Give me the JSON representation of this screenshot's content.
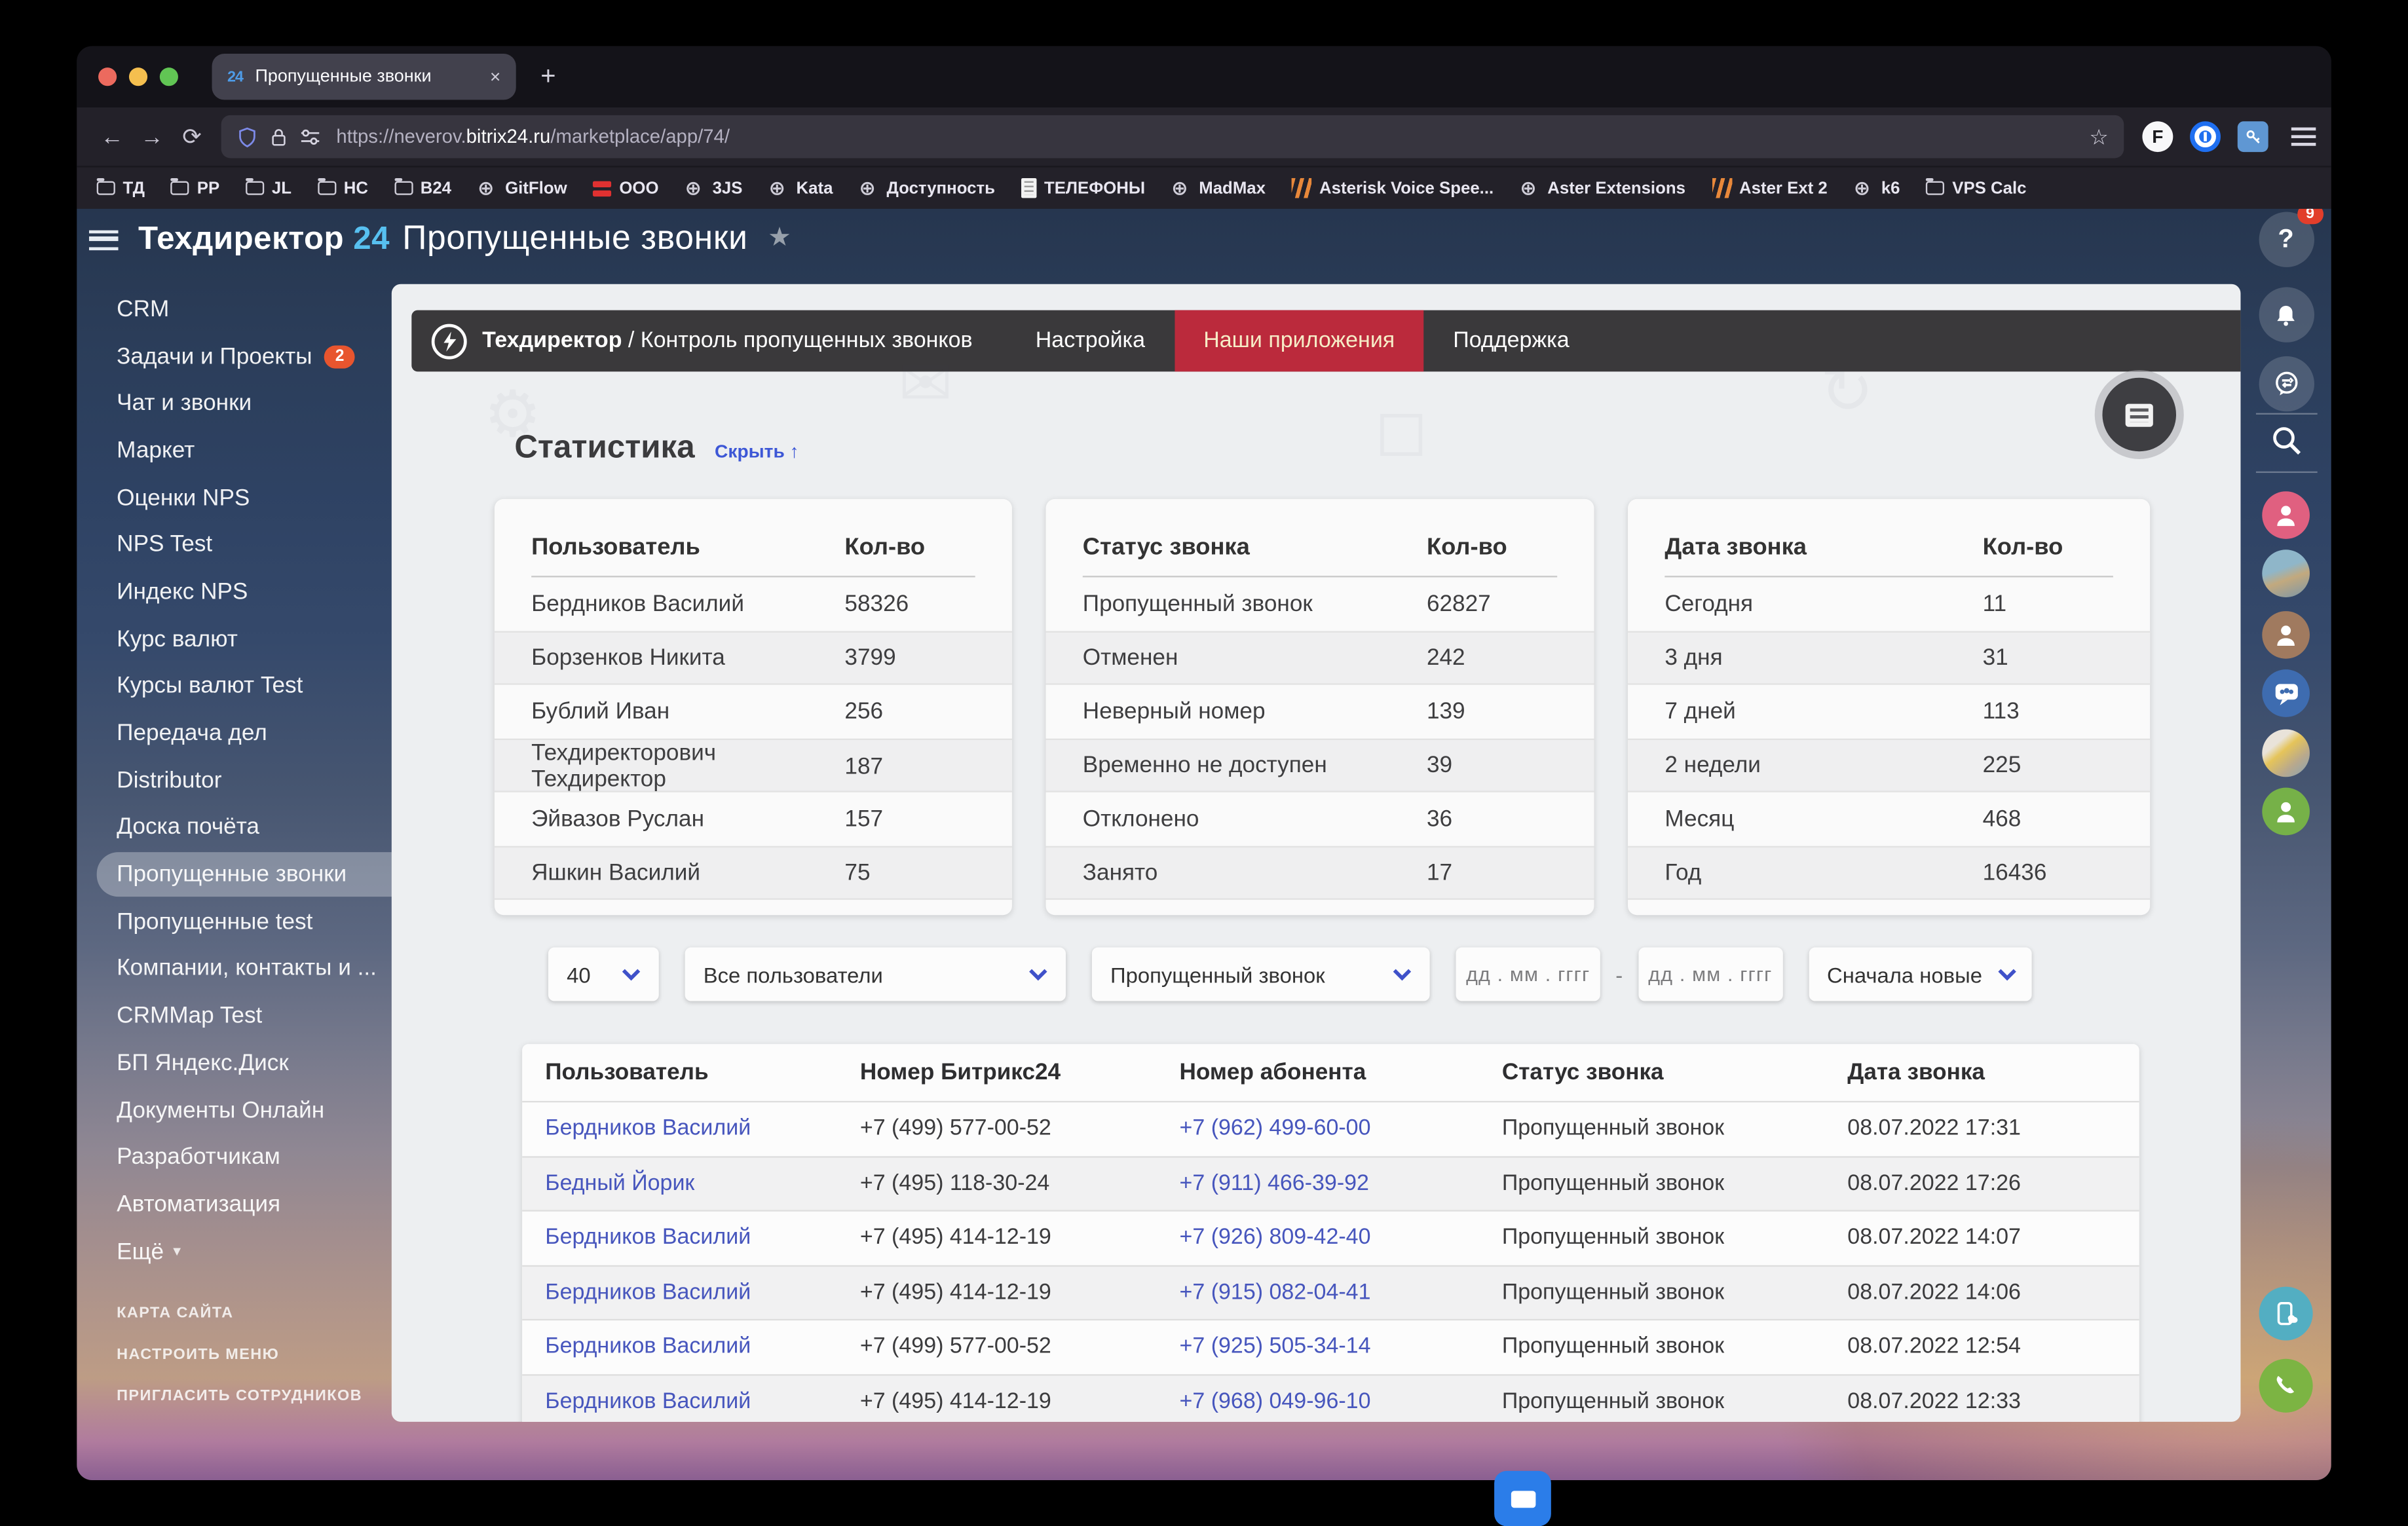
{
  "browser": {
    "tab": {
      "favicon": "24",
      "title": "Пропущенные звонки",
      "close": "×"
    },
    "newtab": "+",
    "nav": {
      "back": "←",
      "forward": "→",
      "reload": "⟳"
    },
    "url": {
      "prefix": "https://neverov.",
      "domain": "bitrix24.ru",
      "path": "/marketplace/app/74/"
    },
    "extension_f": "F",
    "bookmarks": [
      {
        "label": "ТД",
        "icon": "icon-folder"
      },
      {
        "label": "PP",
        "icon": "icon-folder"
      },
      {
        "label": "JL",
        "icon": "icon-folder"
      },
      {
        "label": "НС",
        "icon": "icon-folder"
      },
      {
        "label": "B24",
        "icon": "icon-folder"
      },
      {
        "label": "GitFlow",
        "icon": "icon-globe"
      },
      {
        "label": "ООО",
        "icon": "icon-red"
      },
      {
        "label": "3JS",
        "icon": "icon-globe"
      },
      {
        "label": "Kata",
        "icon": "icon-globe"
      },
      {
        "label": "Доступность",
        "icon": "icon-globe"
      },
      {
        "label": "ТЕЛЕФОНЫ",
        "icon": "icon-doc"
      },
      {
        "label": "MadMax",
        "icon": "icon-globe"
      },
      {
        "label": "Asterisk Voice Spee...",
        "icon": "icon-orange"
      },
      {
        "label": "Aster Extensions",
        "icon": "icon-globe"
      },
      {
        "label": "Aster Ext 2",
        "icon": "icon-orange"
      },
      {
        "label": "k6",
        "icon": "icon-globe"
      },
      {
        "label": "VPS Calc",
        "icon": "icon-folder"
      }
    ]
  },
  "sidebar": {
    "logo_text": "Техдиректор",
    "logo_accent": "24",
    "items": [
      {
        "label": "CRM",
        "badge": "",
        "extra": ""
      },
      {
        "label": "Задачи и Проекты",
        "badge": "2",
        "extra": ""
      },
      {
        "label": "Чат и звонки",
        "badge": "",
        "extra": ""
      },
      {
        "label": "Маркет",
        "badge": "",
        "extra": ""
      },
      {
        "label": "Оценки NPS",
        "badge": "",
        "extra": ""
      },
      {
        "label": "NPS Test",
        "badge": "",
        "extra": ""
      },
      {
        "label": "Индекс NPS",
        "badge": "",
        "extra": ""
      },
      {
        "label": "Курс валют",
        "badge": "",
        "extra": ""
      },
      {
        "label": "Курсы валют Test",
        "badge": "",
        "extra": ""
      },
      {
        "label": "Передача дел",
        "badge": "",
        "extra": ""
      },
      {
        "label": "Distributor",
        "badge": "",
        "extra": ""
      },
      {
        "label": "Доска почёта",
        "badge": "",
        "extra": ""
      },
      {
        "label": "Пропущенные звонки",
        "badge": "",
        "extra": "active"
      },
      {
        "label": "Пропущенные test",
        "badge": "",
        "extra": ""
      },
      {
        "label": "Компании, контакты и ...",
        "badge": "",
        "extra": ""
      },
      {
        "label": "CRMMap Test",
        "badge": "",
        "extra": ""
      },
      {
        "label": "БП Яндекс.Диск",
        "badge": "",
        "extra": ""
      },
      {
        "label": "Документы Онлайн",
        "badge": "",
        "extra": ""
      },
      {
        "label": "Разработчикам",
        "badge": "",
        "extra": ""
      },
      {
        "label": "Автоматизация",
        "badge": "",
        "extra": ""
      },
      {
        "label": "Ещё",
        "badge": "",
        "extra": "more"
      }
    ],
    "footer": [
      "КАРТА САЙТА",
      "НАСТРОИТЬ МЕНЮ",
      "ПРИГЛАСИТЬ СОТРУДНИКОВ"
    ]
  },
  "header": {
    "title": "Пропущенные звонки"
  },
  "appnav": {
    "brand": "Техдиректор",
    "breadcrumb": " / Контроль пропущенных звонков",
    "items": [
      {
        "label": "Настройка",
        "extra": ""
      },
      {
        "label": "Наши приложения",
        "extra": "active"
      },
      {
        "label": "Поддержка",
        "extra": ""
      }
    ]
  },
  "stats": {
    "title": "Статистика",
    "hide_link": "Скрыть ↑",
    "tables": [
      {
        "headers": [
          "Пользователь",
          "Кол-во"
        ],
        "rows": [
          [
            "Бердников Василий",
            "58326"
          ],
          [
            "Борзенков Никита",
            "3799"
          ],
          [
            "Бублий Иван",
            "256"
          ],
          [
            "Техдиректорович Техдиректор",
            "187"
          ],
          [
            "Эйвазов Руслан",
            "157"
          ],
          [
            "Яшкин Василий",
            "75"
          ]
        ]
      },
      {
        "headers": [
          "Статус звонка",
          "Кол-во"
        ],
        "rows": [
          [
            "Пропущенный звонок",
            "62827"
          ],
          [
            "Отменен",
            "242"
          ],
          [
            "Неверный номер",
            "139"
          ],
          [
            "Временно не доступен",
            "39"
          ],
          [
            "Отклонено",
            "36"
          ],
          [
            "Занято",
            "17"
          ]
        ]
      },
      {
        "headers": [
          "Дата звонка",
          "Кол-во"
        ],
        "rows": [
          [
            "Сегодня",
            "11"
          ],
          [
            "3 дня",
            "31"
          ],
          [
            "7 дней",
            "113"
          ],
          [
            "2 недели",
            "225"
          ],
          [
            "Месяц",
            "468"
          ],
          [
            "Год",
            "16436"
          ]
        ]
      }
    ]
  },
  "filters": {
    "page_size": "40",
    "user": "Все пользователи",
    "status": "Пропущенный звонок",
    "date_from": "дд . мм . гггг",
    "date_separator": "-",
    "date_to": "дд . мм . гггг",
    "sort": "Сначала новые"
  },
  "calls": {
    "headers": [
      "Пользователь",
      "Номер Битрикс24",
      "Номер абонента",
      "Статус звонка",
      "Дата звонка"
    ],
    "rows": [
      {
        "user": "Бердников Василий",
        "b24": "+7 (499) 577-00-52",
        "abonent": "+7 (962) 499-60-00",
        "status": "Пропущенный звонок",
        "date": "08.07.2022 17:31"
      },
      {
        "user": "Бедный Йорик",
        "b24": "+7 (495) 118-30-24",
        "abonent": "+7 (911) 466-39-92",
        "status": "Пропущенный звонок",
        "date": "08.07.2022 17:26"
      },
      {
        "user": "Бердников Василий",
        "b24": "+7 (495) 414-12-19",
        "abonent": "+7 (926) 809-42-40",
        "status": "Пропущенный звонок",
        "date": "08.07.2022 14:07"
      },
      {
        "user": "Бердников Василий",
        "b24": "+7 (495) 414-12-19",
        "abonent": "+7 (915) 082-04-41",
        "status": "Пропущенный звонок",
        "date": "08.07.2022 14:06"
      },
      {
        "user": "Бердников Василий",
        "b24": "+7 (499) 577-00-52",
        "abonent": "+7 (925) 505-34-14",
        "status": "Пропущенный звонок",
        "date": "08.07.2022 12:54"
      },
      {
        "user": "Бердников Василий",
        "b24": "+7 (495) 414-12-19",
        "abonent": "+7 (968) 049-96-10",
        "status": "Пропущенный звонок",
        "date": "08.07.2022 12:33"
      }
    ]
  },
  "rail": {
    "help_glyph": "?",
    "help_badge": "9"
  },
  "colors": {
    "nav_active_bg": "#bb2a3c",
    "nav_active_text": "#f6ecc7",
    "link_blue": "#4756bd",
    "sidebar_badge": "#e8552e",
    "help_badge": "#e23e2b",
    "logo_accent": "#57c0f0",
    "select_chevron": "#3f51c9"
  }
}
